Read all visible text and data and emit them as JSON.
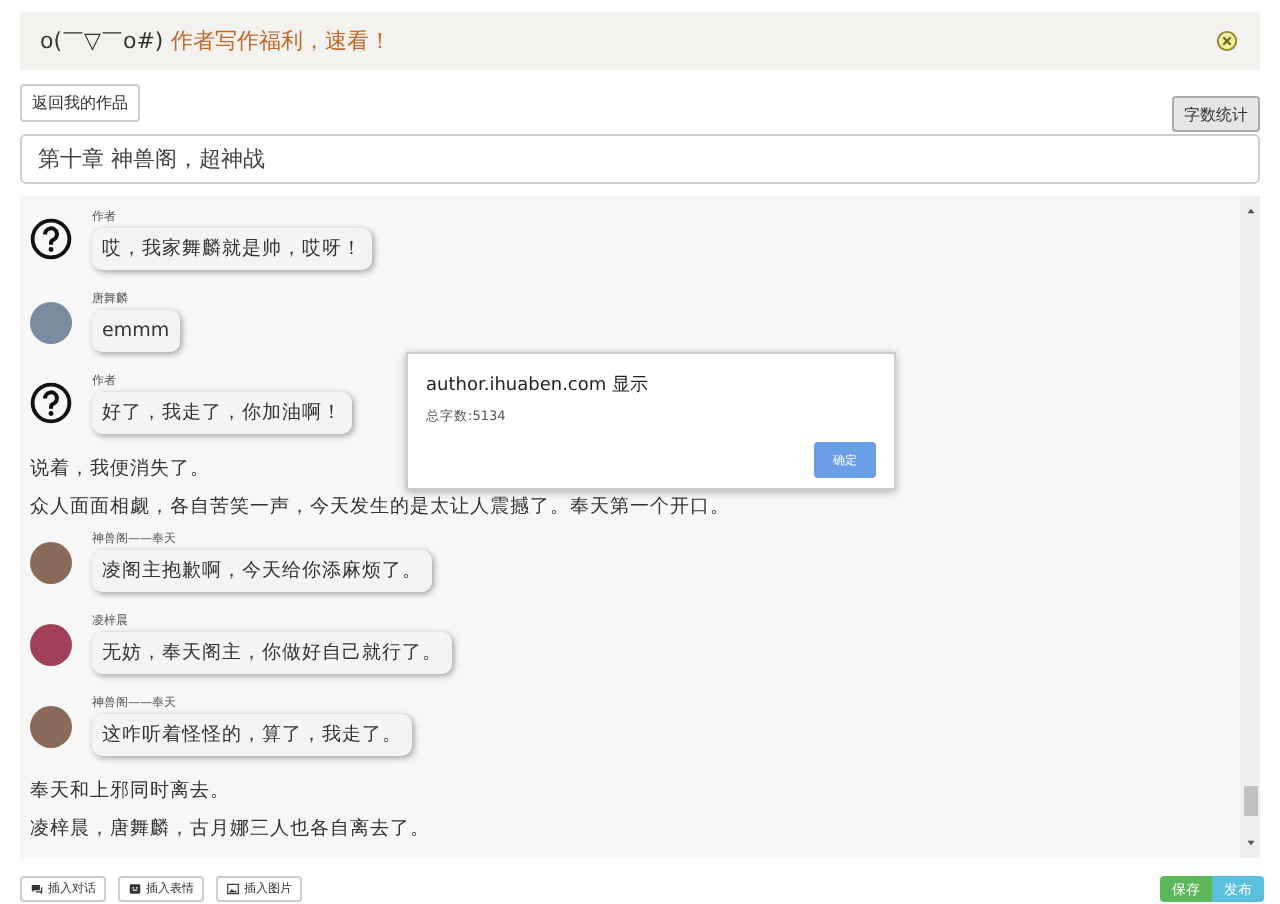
{
  "notice": {
    "emoticon": "o(￣▽￣o#)",
    "text": "作者写作福利，速看！"
  },
  "back_button": "返回我的作品",
  "count_button": "字数统计",
  "chapter_title": "第十章 神兽阁，超神战",
  "messages": [
    {
      "kind": "author",
      "speaker": "作者",
      "text": "哎，我家舞麟就是帅，哎呀！"
    },
    {
      "kind": "character",
      "color": "#7a8aa0",
      "speaker": "唐舞麟",
      "text": "emmm"
    },
    {
      "kind": "author",
      "speaker": "作者",
      "text": "好了，我走了，你加油啊！"
    },
    {
      "kind": "narration",
      "text": "说着，我便消失了。"
    },
    {
      "kind": "narration",
      "text": "众人面面相觑，各自苦笑一声，今天发生的是太让人震撼了。奉天第一个开口。"
    },
    {
      "kind": "character",
      "color": "#8a6a58",
      "speaker": "神兽阁——奉天",
      "text": "凌阁主抱歉啊，今天给你添麻烦了。"
    },
    {
      "kind": "character",
      "color": "#a0405a",
      "speaker": "凌梓晨",
      "text": "无妨，奉天阁主，你做好自己就行了。"
    },
    {
      "kind": "character",
      "color": "#8a6a58",
      "speaker": "神兽阁——奉天",
      "text": "这咋听着怪怪的，算了，我走了。"
    },
    {
      "kind": "narration",
      "text": "奉天和上邪同时离去。"
    },
    {
      "kind": "narration",
      "text": "凌梓晨，唐舞麟，古月娜三人也各自离去了。"
    }
  ],
  "alert": {
    "title": "author.ihuaben.com 显示",
    "message": "总字数:5134",
    "ok_button": "确定"
  },
  "tools": [
    {
      "kind": "dialog",
      "label": "插入对话"
    },
    {
      "kind": "emoji",
      "label": "插入表情"
    },
    {
      "kind": "image",
      "label": "插入图片"
    }
  ],
  "actions": [
    {
      "kind": "save",
      "label": "保存"
    },
    {
      "kind": "publish",
      "label": "发布"
    }
  ]
}
